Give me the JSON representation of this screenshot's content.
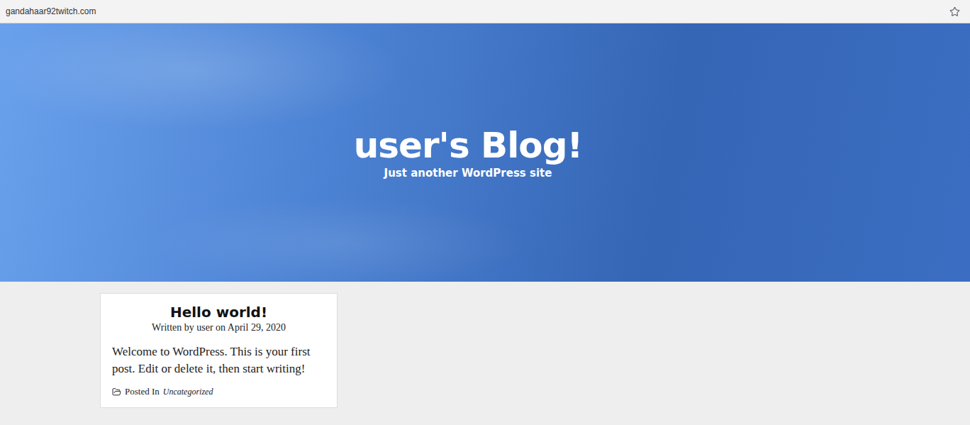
{
  "browser": {
    "url": "gandahaar92twitch.com",
    "bookmarked": false
  },
  "header": {
    "title": "user's Blog!",
    "tagline": "Just another WordPress site"
  },
  "posts": [
    {
      "title": "Hello world!",
      "byline": "Written by user on April 29, 2020",
      "excerpt": "Welcome to WordPress. This is your first post. Edit or delete it, then start writing!",
      "category_label": "Posted In",
      "category": "Uncategorized"
    }
  ]
}
